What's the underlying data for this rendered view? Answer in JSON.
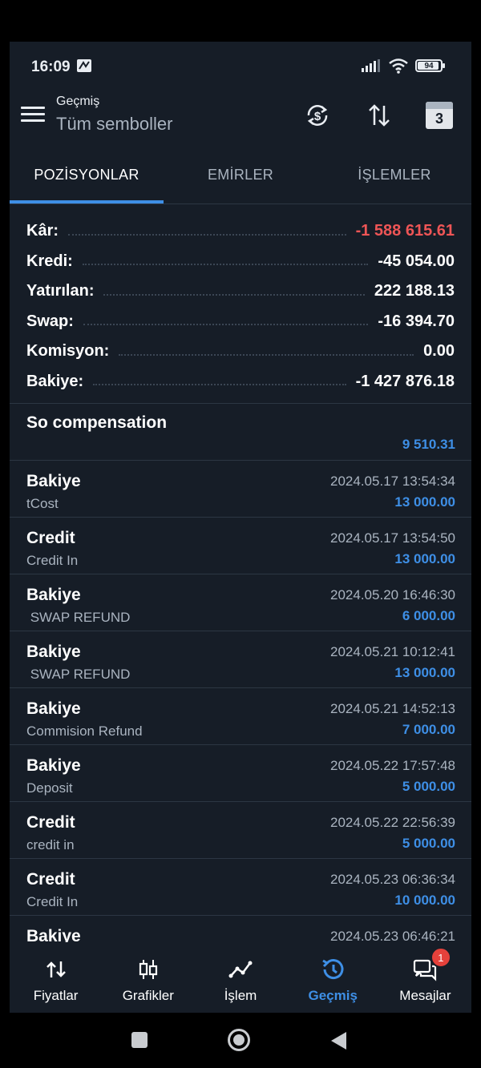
{
  "status_bar": {
    "time": "16:09",
    "battery": "94"
  },
  "header": {
    "subtitle": "Geçmiş",
    "title": "Tüm semboller",
    "calendar_day": "3"
  },
  "tabs": [
    {
      "label": "POZİSYONLAR",
      "active": true
    },
    {
      "label": "EMİRLER",
      "active": false
    },
    {
      "label": "İŞLEMLER",
      "active": false
    }
  ],
  "summary": [
    {
      "label": "Kâr:",
      "value": "-1 588 615.61",
      "color": "#ee5556"
    },
    {
      "label": "Kredi:",
      "value": "-45 054.00"
    },
    {
      "label": "Yatırılan:",
      "value": "222 188.13"
    },
    {
      "label": "Swap:",
      "value": "-16 394.70"
    },
    {
      "label": "Komisyon:",
      "value": "0.00"
    },
    {
      "label": "Bakiye:",
      "value": "-1 427 876.18"
    }
  ],
  "compensation": {
    "title": "So compensation",
    "amount": "9 510.31"
  },
  "transactions": [
    {
      "title": "Bakiye",
      "comment": "tCost",
      "date": "2024.05.17 13:54:34",
      "amount": "13 000.00"
    },
    {
      "title": "Credit",
      "comment": "Credit In",
      "date": "2024.05.17 13:54:50",
      "amount": "13 000.00"
    },
    {
      "title": "Bakiye",
      "comment": " SWAP REFUND",
      "date": "2024.05.20 16:46:30",
      "amount": "6 000.00"
    },
    {
      "title": "Bakiye",
      "comment": " SWAP REFUND",
      "date": "2024.05.21 10:12:41",
      "amount": "13 000.00"
    },
    {
      "title": "Bakiye",
      "comment": "Commision Refund",
      "date": "2024.05.21 14:52:13",
      "amount": "7 000.00"
    },
    {
      "title": "Bakiye",
      "comment": "Deposit",
      "date": "2024.05.22 17:57:48",
      "amount": "5 000.00"
    },
    {
      "title": "Credit",
      "comment": "credit in",
      "date": "2024.05.22 22:56:39",
      "amount": "5 000.00"
    },
    {
      "title": "Credit",
      "comment": "Credit In",
      "date": "2024.05.23 06:36:34",
      "amount": "10 000.00"
    },
    {
      "title": "Bakiye",
      "comment": "",
      "date": "2024.05.23 06:46:21",
      "amount": ""
    }
  ],
  "bottom_nav": [
    {
      "label": "Fiyatlar",
      "icon": "arrows-updown-icon"
    },
    {
      "label": "Grafikler",
      "icon": "candlestick-icon"
    },
    {
      "label": "İşlem",
      "icon": "trade-line-icon"
    },
    {
      "label": "Geçmiş",
      "icon": "history-icon",
      "active": true
    },
    {
      "label": "Mesajlar",
      "icon": "chat-icon",
      "badge": "1"
    }
  ],
  "colors": {
    "accent": "#3e8fe6",
    "negative": "#ee5556",
    "background": "#161d27"
  }
}
